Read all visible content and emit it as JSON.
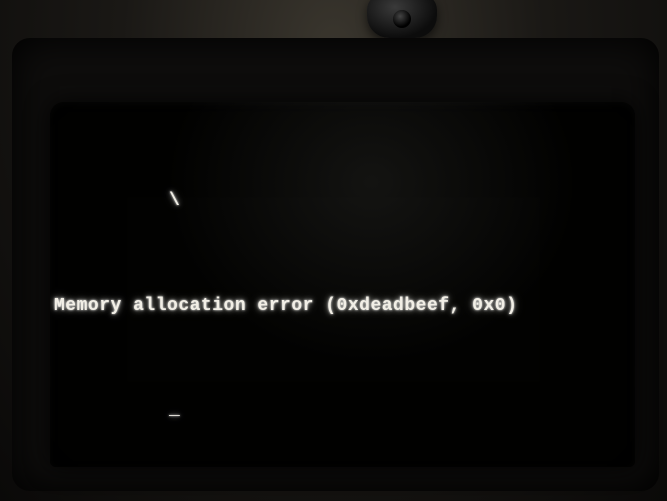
{
  "terminal": {
    "line1_spinner": "\\",
    "line2_message": "Memory allocation error (0xdeadbeef, 0x0)",
    "cursor": "_"
  }
}
